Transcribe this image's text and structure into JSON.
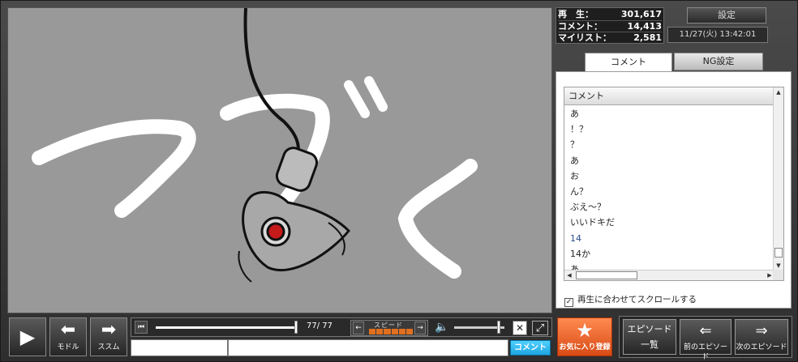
{
  "stats": {
    "views_label": "再　生：",
    "views": "301,617",
    "comments_label": "コメント：",
    "comments": "14,413",
    "mylist_label": "マイリスト：",
    "mylist": "2,581"
  },
  "settings_label": "設定",
  "datetime": "11/27(火) 13:42:01",
  "tabs": {
    "comment": "コメント",
    "ng": "NG設定"
  },
  "comment_list": {
    "header": "コメント",
    "rows": [
      "あ",
      "！？",
      "？",
      "あ",
      "お",
      "ん？",
      "ぶえ～？",
      "いいドキだ",
      "14",
      "14か",
      "あ"
    ]
  },
  "autoscroll": {
    "checked_mark": "✓",
    "label": "再生に合わせてスクロールする"
  },
  "player": {
    "play_icon": "play-icon",
    "back_label": "モドル",
    "forward_label": "ススム",
    "time_display": "77/  77",
    "speed_label": "スピード",
    "seek_fraction": 1.0,
    "volume_fraction": 0.9,
    "close_glyph": "✕",
    "fullscreen_glyph": "⤢"
  },
  "comment_form": {
    "command_value": "",
    "comment_value": "",
    "submit_label": "コメント"
  },
  "favorite_label": "お気に入り登録",
  "episodes": {
    "list_line1": "エピソード",
    "list_line2": "一覧",
    "prev_label": "前のエピソード",
    "next_label": "次のエピソード"
  },
  "colors": {
    "video_bg": "#999999",
    "accent_orange": "#e85a20",
    "submit_blue": "#1ea5e0"
  }
}
